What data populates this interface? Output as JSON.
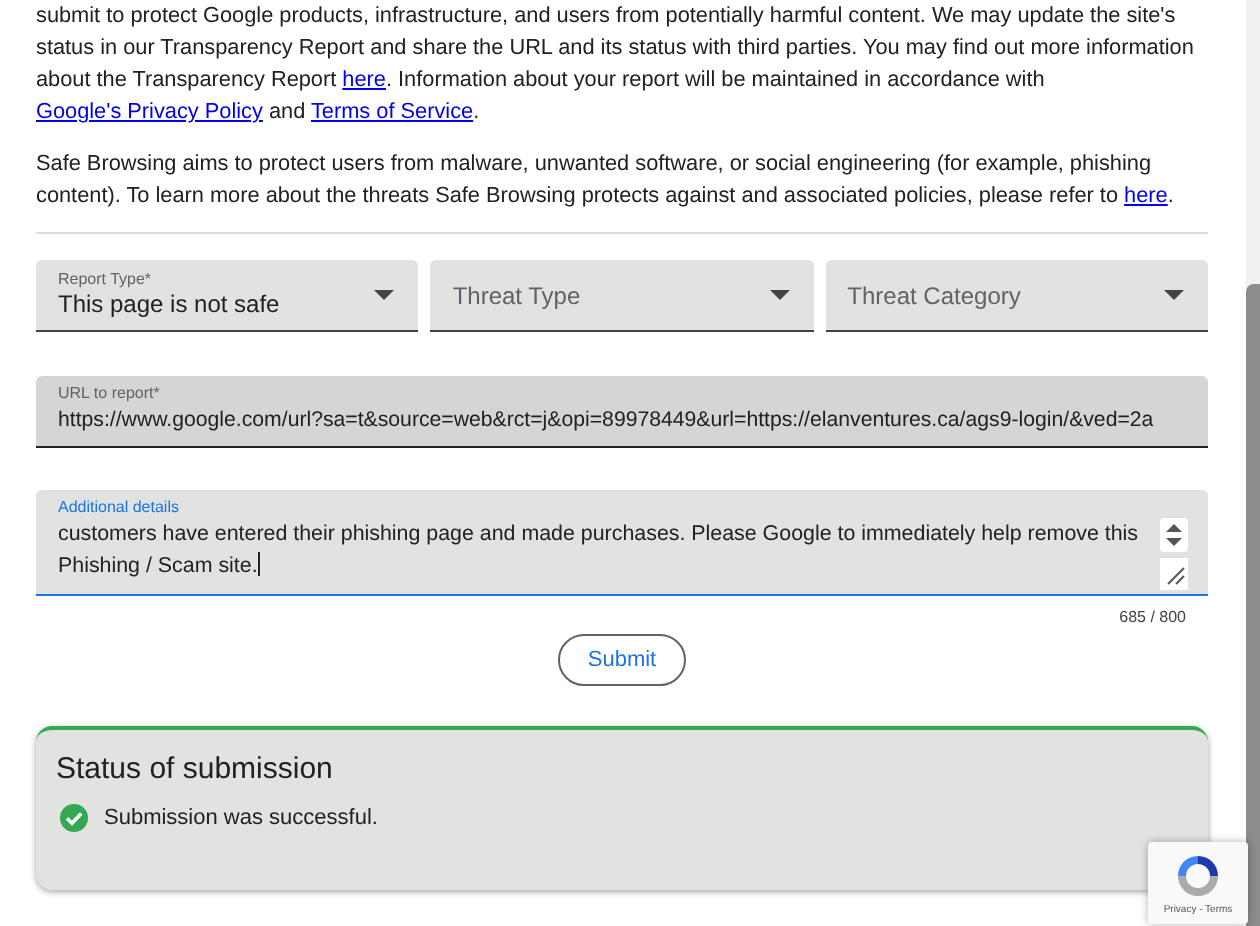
{
  "paragraphs": [
    {
      "parts": [
        {
          "kind": "text",
          "text": "submit to protect Google products, infrastructure, and users from potentially harmful content. We may update the site's status in our Transparency Report and share the URL and its status with third parties. You may find out more information about the Transparency Report "
        },
        {
          "kind": "link",
          "text": "here"
        },
        {
          "kind": "text",
          "text": ". Information about your report will be maintained in accordance with "
        },
        {
          "kind": "link",
          "text": "Google's Privacy Policy"
        },
        {
          "kind": "text",
          "text": " and "
        },
        {
          "kind": "link",
          "text": "Terms of Service"
        },
        {
          "kind": "text",
          "text": "."
        }
      ]
    },
    {
      "parts": [
        {
          "kind": "text",
          "text": "Safe Browsing aims to protect users from malware, unwanted software, or social engineering (for example, phishing content). To learn more about the threats Safe Browsing protects against and associated policies, please refer to "
        },
        {
          "kind": "link",
          "text": "here"
        },
        {
          "kind": "text",
          "text": "."
        }
      ]
    }
  ],
  "dropdowns": [
    {
      "label": "Report Type*",
      "value": "This page is not safe"
    },
    {
      "placeholder": "Threat Type"
    },
    {
      "placeholder": "Threat Category"
    }
  ],
  "url_field": {
    "label": "URL to report*",
    "value": "https://www.google.com/url?sa=t&source=web&rct=j&opi=89978449&url=https://elanventures.ca/ags9-login/&ved=2a"
  },
  "details_field": {
    "label": "Additional details",
    "value": "customers have entered their phishing page and made purchases. Please Google to immediately help remove this Phishing / Scam site.",
    "focused": true,
    "counter": "685 / 800"
  },
  "submit_button": "Submit",
  "status": {
    "title": "Status of submission",
    "message": "Submission was successful.",
    "successful": true
  },
  "recaptcha": {
    "links": "Privacy - Terms"
  }
}
